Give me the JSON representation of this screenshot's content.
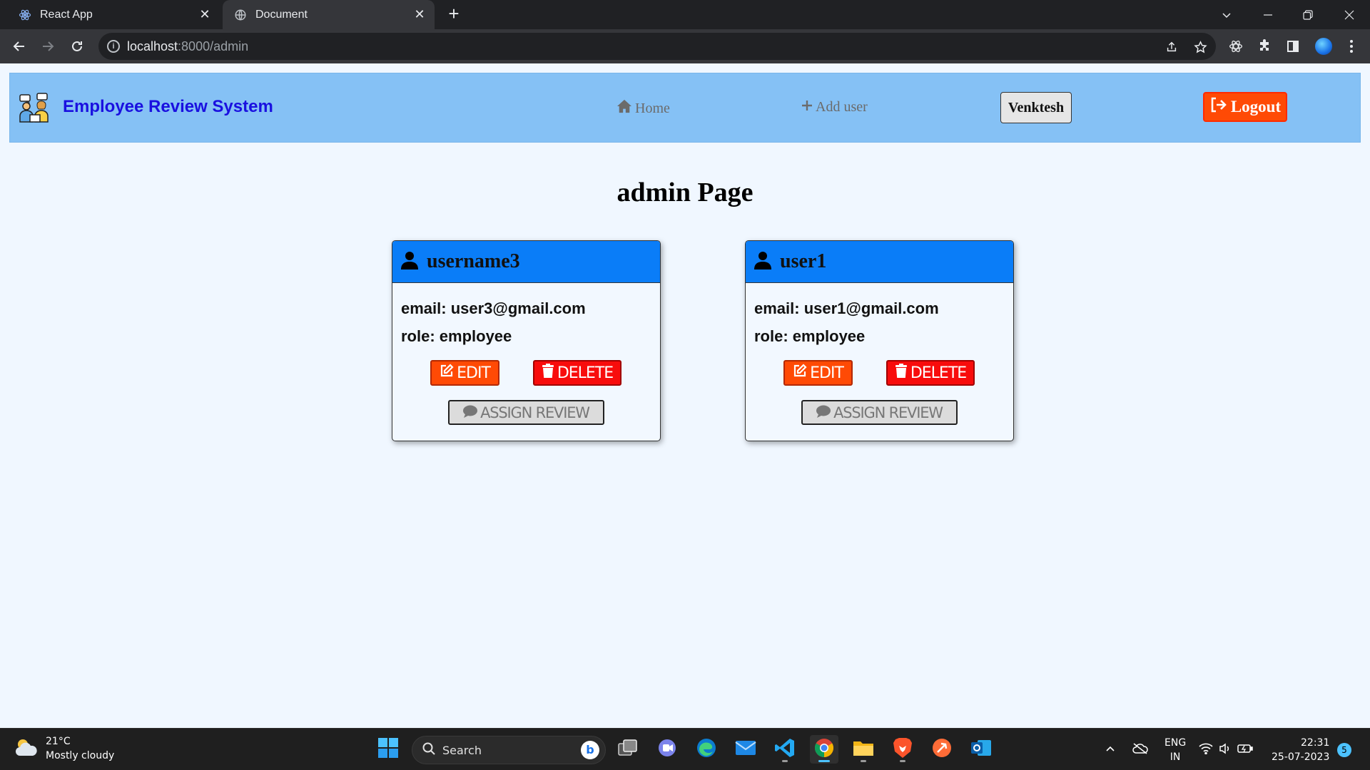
{
  "browser": {
    "tabs": [
      {
        "title": "React App",
        "active": false,
        "icon": "react-icon"
      },
      {
        "title": "Document",
        "active": true,
        "icon": "globe-icon"
      }
    ],
    "url_host": "localhost",
    "url_path": ":8000/admin"
  },
  "navbar": {
    "brand": "Employee Review System",
    "home_label": "Home",
    "add_user_label": "Add user",
    "current_user": "Venktesh",
    "logout_label": "Logout"
  },
  "page": {
    "title": "admin Page"
  },
  "users": [
    {
      "username": "username3",
      "email_line": "email: user3@gmail.com",
      "role_line": "role: employee",
      "edit_label": "EDIT",
      "delete_label": "DELETE",
      "assign_label": "ASSIGN REVIEW"
    },
    {
      "username": "user1",
      "email_line": "email: user1@gmail.com",
      "role_line": "role: employee",
      "edit_label": "EDIT",
      "delete_label": "DELETE",
      "assign_label": "ASSIGN REVIEW"
    }
  ],
  "taskbar": {
    "temperature": "21°C",
    "weather": "Mostly cloudy",
    "search_label": "Search",
    "lang_top": "ENG",
    "lang_bottom": "IN",
    "time": "22:31",
    "date": "25-07-2023",
    "notification_count": "5"
  },
  "colors": {
    "navbar_bg": "#85c1f5",
    "brand_text": "#1a10e0",
    "card_header": "#0a7df8",
    "edit_button": "#ff4a05",
    "delete_button": "#f80c0c",
    "logout_button": "#ff4a05",
    "page_bg": "#f0f7ff"
  }
}
